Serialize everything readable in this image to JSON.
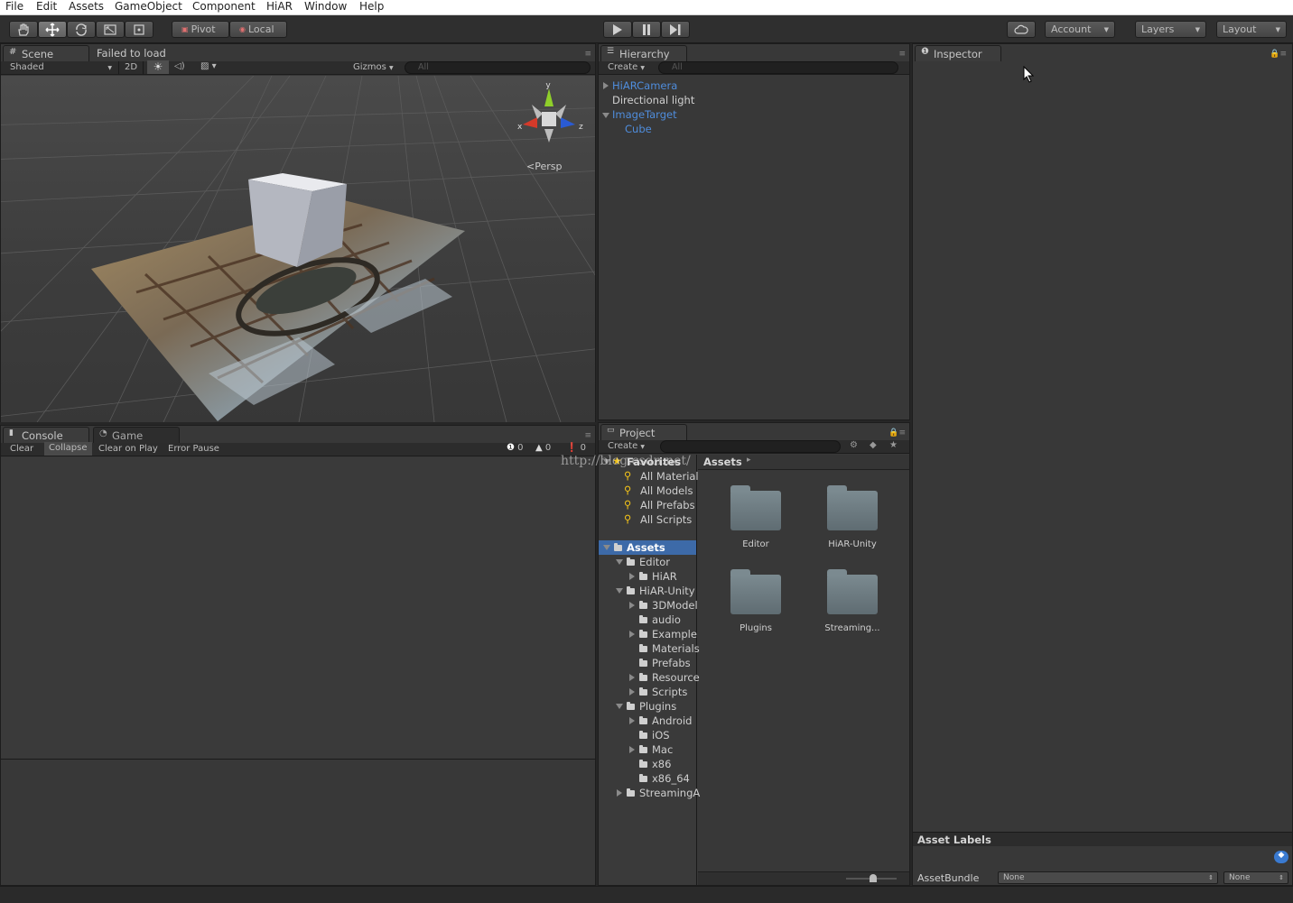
{
  "menu": [
    "File",
    "Edit",
    "Assets",
    "GameObject",
    "Component",
    "HiAR",
    "Window",
    "Help"
  ],
  "toolbar": {
    "pivot": "Pivot",
    "local": "Local",
    "account": "Account",
    "layers": "Layers",
    "layout": "Layout"
  },
  "scene": {
    "tab": "Scene",
    "failed": "Failed to load",
    "shaded": "Shaded",
    "mode2d": "2D",
    "gizmos": "Gizmos",
    "search_placeholder": "All",
    "persp": "Persp",
    "axis_x": "x",
    "axis_y": "y",
    "axis_z": "z"
  },
  "hierarchy": {
    "tab": "Hierarchy",
    "create": "Create",
    "search_placeholder": "All",
    "items": [
      "HiARCamera",
      "Directional light",
      "ImageTarget",
      "Cube"
    ]
  },
  "inspector": {
    "tab": "Inspector",
    "asset_labels": "Asset Labels",
    "asset_bundle": "AssetBundle",
    "none1": "None",
    "none2": "None"
  },
  "console": {
    "tab": "Console",
    "game_tab": "Game",
    "clear": "Clear",
    "collapse": "Collapse",
    "clear_on_play": "Clear on Play",
    "error_pause": "Error Pause",
    "count_info": "0",
    "count_warn": "0",
    "count_err": "0"
  },
  "project": {
    "tab": "Project",
    "create": "Create",
    "favorites": "Favorites",
    "fav_items": [
      "All Material",
      "All Models",
      "All Prefabs",
      "All Scripts"
    ],
    "breadcrumb": "Assets",
    "tree": {
      "assets": "Assets",
      "editor": "Editor",
      "hiar": "HiAR",
      "hiar_unity": "HiAR-Unity",
      "models": "3DModel",
      "audio": "audio",
      "example": "Example",
      "materials": "Materials",
      "prefabs": "Prefabs",
      "resource": "Resource",
      "scripts": "Scripts",
      "plugins": "Plugins",
      "android": "Android",
      "ios": "iOS",
      "mac": "Mac",
      "x86": "x86",
      "x86_64": "x86_64",
      "streaming": "StreamingA"
    },
    "grid": [
      "Editor",
      "HiAR-Unity",
      "Plugins",
      "Streaming..."
    ]
  },
  "watermark": "http://blog.csdn.net/"
}
